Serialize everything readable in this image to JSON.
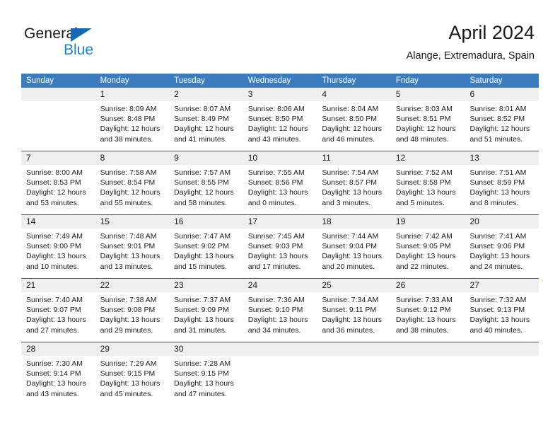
{
  "brand": {
    "name_part1": "General",
    "name_part2": "Blue"
  },
  "header": {
    "month_title": "April 2024",
    "location": "Alange, Extremadura, Spain"
  },
  "colors": {
    "header_blue": "#3b7cbf",
    "separator_blue": "#1f5fa0",
    "number_band": "#efefef",
    "brand_blue": "#1b7fd4",
    "text": "#1a1a1a"
  },
  "calendar": {
    "day_headers": [
      "Sunday",
      "Monday",
      "Tuesday",
      "Wednesday",
      "Thursday",
      "Friday",
      "Saturday"
    ],
    "weeks": [
      [
        {
          "day": "",
          "sunrise": "",
          "sunset": "",
          "daylight_line1": "",
          "daylight_line2": ""
        },
        {
          "day": "1",
          "sunrise": "Sunrise: 8:09 AM",
          "sunset": "Sunset: 8:48 PM",
          "daylight_line1": "Daylight: 12 hours",
          "daylight_line2": "and 38 minutes."
        },
        {
          "day": "2",
          "sunrise": "Sunrise: 8:07 AM",
          "sunset": "Sunset: 8:49 PM",
          "daylight_line1": "Daylight: 12 hours",
          "daylight_line2": "and 41 minutes."
        },
        {
          "day": "3",
          "sunrise": "Sunrise: 8:06 AM",
          "sunset": "Sunset: 8:50 PM",
          "daylight_line1": "Daylight: 12 hours",
          "daylight_line2": "and 43 minutes."
        },
        {
          "day": "4",
          "sunrise": "Sunrise: 8:04 AM",
          "sunset": "Sunset: 8:50 PM",
          "daylight_line1": "Daylight: 12 hours",
          "daylight_line2": "and 46 minutes."
        },
        {
          "day": "5",
          "sunrise": "Sunrise: 8:03 AM",
          "sunset": "Sunset: 8:51 PM",
          "daylight_line1": "Daylight: 12 hours",
          "daylight_line2": "and 48 minutes."
        },
        {
          "day": "6",
          "sunrise": "Sunrise: 8:01 AM",
          "sunset": "Sunset: 8:52 PM",
          "daylight_line1": "Daylight: 12 hours",
          "daylight_line2": "and 51 minutes."
        }
      ],
      [
        {
          "day": "7",
          "sunrise": "Sunrise: 8:00 AM",
          "sunset": "Sunset: 8:53 PM",
          "daylight_line1": "Daylight: 12 hours",
          "daylight_line2": "and 53 minutes."
        },
        {
          "day": "8",
          "sunrise": "Sunrise: 7:58 AM",
          "sunset": "Sunset: 8:54 PM",
          "daylight_line1": "Daylight: 12 hours",
          "daylight_line2": "and 55 minutes."
        },
        {
          "day": "9",
          "sunrise": "Sunrise: 7:57 AM",
          "sunset": "Sunset: 8:55 PM",
          "daylight_line1": "Daylight: 12 hours",
          "daylight_line2": "and 58 minutes."
        },
        {
          "day": "10",
          "sunrise": "Sunrise: 7:55 AM",
          "sunset": "Sunset: 8:56 PM",
          "daylight_line1": "Daylight: 13 hours",
          "daylight_line2": "and 0 minutes."
        },
        {
          "day": "11",
          "sunrise": "Sunrise: 7:54 AM",
          "sunset": "Sunset: 8:57 PM",
          "daylight_line1": "Daylight: 13 hours",
          "daylight_line2": "and 3 minutes."
        },
        {
          "day": "12",
          "sunrise": "Sunrise: 7:52 AM",
          "sunset": "Sunset: 8:58 PM",
          "daylight_line1": "Daylight: 13 hours",
          "daylight_line2": "and 5 minutes."
        },
        {
          "day": "13",
          "sunrise": "Sunrise: 7:51 AM",
          "sunset": "Sunset: 8:59 PM",
          "daylight_line1": "Daylight: 13 hours",
          "daylight_line2": "and 8 minutes."
        }
      ],
      [
        {
          "day": "14",
          "sunrise": "Sunrise: 7:49 AM",
          "sunset": "Sunset: 9:00 PM",
          "daylight_line1": "Daylight: 13 hours",
          "daylight_line2": "and 10 minutes."
        },
        {
          "day": "15",
          "sunrise": "Sunrise: 7:48 AM",
          "sunset": "Sunset: 9:01 PM",
          "daylight_line1": "Daylight: 13 hours",
          "daylight_line2": "and 13 minutes."
        },
        {
          "day": "16",
          "sunrise": "Sunrise: 7:47 AM",
          "sunset": "Sunset: 9:02 PM",
          "daylight_line1": "Daylight: 13 hours",
          "daylight_line2": "and 15 minutes."
        },
        {
          "day": "17",
          "sunrise": "Sunrise: 7:45 AM",
          "sunset": "Sunset: 9:03 PM",
          "daylight_line1": "Daylight: 13 hours",
          "daylight_line2": "and 17 minutes."
        },
        {
          "day": "18",
          "sunrise": "Sunrise: 7:44 AM",
          "sunset": "Sunset: 9:04 PM",
          "daylight_line1": "Daylight: 13 hours",
          "daylight_line2": "and 20 minutes."
        },
        {
          "day": "19",
          "sunrise": "Sunrise: 7:42 AM",
          "sunset": "Sunset: 9:05 PM",
          "daylight_line1": "Daylight: 13 hours",
          "daylight_line2": "and 22 minutes."
        },
        {
          "day": "20",
          "sunrise": "Sunrise: 7:41 AM",
          "sunset": "Sunset: 9:06 PM",
          "daylight_line1": "Daylight: 13 hours",
          "daylight_line2": "and 24 minutes."
        }
      ],
      [
        {
          "day": "21",
          "sunrise": "Sunrise: 7:40 AM",
          "sunset": "Sunset: 9:07 PM",
          "daylight_line1": "Daylight: 13 hours",
          "daylight_line2": "and 27 minutes."
        },
        {
          "day": "22",
          "sunrise": "Sunrise: 7:38 AM",
          "sunset": "Sunset: 9:08 PM",
          "daylight_line1": "Daylight: 13 hours",
          "daylight_line2": "and 29 minutes."
        },
        {
          "day": "23",
          "sunrise": "Sunrise: 7:37 AM",
          "sunset": "Sunset: 9:09 PM",
          "daylight_line1": "Daylight: 13 hours",
          "daylight_line2": "and 31 minutes."
        },
        {
          "day": "24",
          "sunrise": "Sunrise: 7:36 AM",
          "sunset": "Sunset: 9:10 PM",
          "daylight_line1": "Daylight: 13 hours",
          "daylight_line2": "and 34 minutes."
        },
        {
          "day": "25",
          "sunrise": "Sunrise: 7:34 AM",
          "sunset": "Sunset: 9:11 PM",
          "daylight_line1": "Daylight: 13 hours",
          "daylight_line2": "and 36 minutes."
        },
        {
          "day": "26",
          "sunrise": "Sunrise: 7:33 AM",
          "sunset": "Sunset: 9:12 PM",
          "daylight_line1": "Daylight: 13 hours",
          "daylight_line2": "and 38 minutes."
        },
        {
          "day": "27",
          "sunrise": "Sunrise: 7:32 AM",
          "sunset": "Sunset: 9:13 PM",
          "daylight_line1": "Daylight: 13 hours",
          "daylight_line2": "and 40 minutes."
        }
      ],
      [
        {
          "day": "28",
          "sunrise": "Sunrise: 7:30 AM",
          "sunset": "Sunset: 9:14 PM",
          "daylight_line1": "Daylight: 13 hours",
          "daylight_line2": "and 43 minutes."
        },
        {
          "day": "29",
          "sunrise": "Sunrise: 7:29 AM",
          "sunset": "Sunset: 9:15 PM",
          "daylight_line1": "Daylight: 13 hours",
          "daylight_line2": "and 45 minutes."
        },
        {
          "day": "30",
          "sunrise": "Sunrise: 7:28 AM",
          "sunset": "Sunset: 9:15 PM",
          "daylight_line1": "Daylight: 13 hours",
          "daylight_line2": "and 47 minutes."
        },
        {
          "day": "",
          "sunrise": "",
          "sunset": "",
          "daylight_line1": "",
          "daylight_line2": ""
        },
        {
          "day": "",
          "sunrise": "",
          "sunset": "",
          "daylight_line1": "",
          "daylight_line2": ""
        },
        {
          "day": "",
          "sunrise": "",
          "sunset": "",
          "daylight_line1": "",
          "daylight_line2": ""
        },
        {
          "day": "",
          "sunrise": "",
          "sunset": "",
          "daylight_line1": "",
          "daylight_line2": ""
        }
      ]
    ]
  }
}
